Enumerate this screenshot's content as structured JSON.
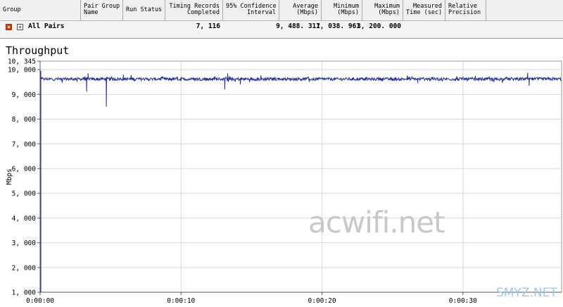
{
  "table": {
    "headers": [
      "Group",
      "Pair Group\nName",
      "Run Status",
      "Timing Records\nCompleted",
      "95% Confidence\nInterval",
      "Average\n(Mbps)",
      "Minimum\n(Mbps)",
      "Maximum\n(Mbps)",
      "Measured\nTime (sec)",
      "Relative\nPrecision"
    ],
    "row": {
      "group": "All Pairs",
      "pair_group_name": "",
      "run_status": "",
      "timing_records": "7, 116",
      "confidence_interval": "",
      "average": "9, 488. 317",
      "minimum": "1, 038. 961",
      "maximum": "3, 200. 000",
      "measured_time": "",
      "relative_precision": ""
    }
  },
  "chart_data": {
    "type": "line",
    "title": "Throughput",
    "ylabel": "Mbps",
    "xlabel": "",
    "ylim": [
      1000,
      10345
    ],
    "y_ticks": [
      "10, 345",
      "10, 000",
      "9, 000",
      "8, 000",
      "7, 000",
      "6, 000",
      "5, 000",
      "4, 000",
      "3, 000",
      "2, 000",
      "1, 000"
    ],
    "y_tick_values": [
      10345,
      10000,
      9000,
      8000,
      7000,
      6000,
      5000,
      4000,
      3000,
      2000,
      1000
    ],
    "x_ticks": [
      "0:00:00",
      "0:00:10",
      "0:00:20",
      "0:00:30"
    ],
    "x_tick_values": [
      0,
      10,
      20,
      30
    ],
    "xlim": [
      0,
      37
    ],
    "grid": true,
    "series": [
      {
        "color": "#1e2a9c",
        "baseline": 9620,
        "noise": 60,
        "start": [
          [
            0,
            9950
          ],
          [
            0.05,
            9700
          ]
        ],
        "spikes": [
          [
            3.3,
            9100
          ],
          [
            3.4,
            9850
          ],
          [
            4.7,
            8500
          ],
          [
            13.1,
            9200
          ],
          [
            13.3,
            9850
          ],
          [
            5.9,
            9800
          ],
          [
            26.8,
            9450
          ],
          [
            34.7,
            9350
          ],
          [
            34.6,
            9880
          ],
          [
            14.2,
            9400
          ],
          [
            30.0,
            9720
          ]
        ]
      }
    ]
  },
  "watermarks": {
    "main": "acwifi.net",
    "corner": "SMYZ.NET"
  }
}
